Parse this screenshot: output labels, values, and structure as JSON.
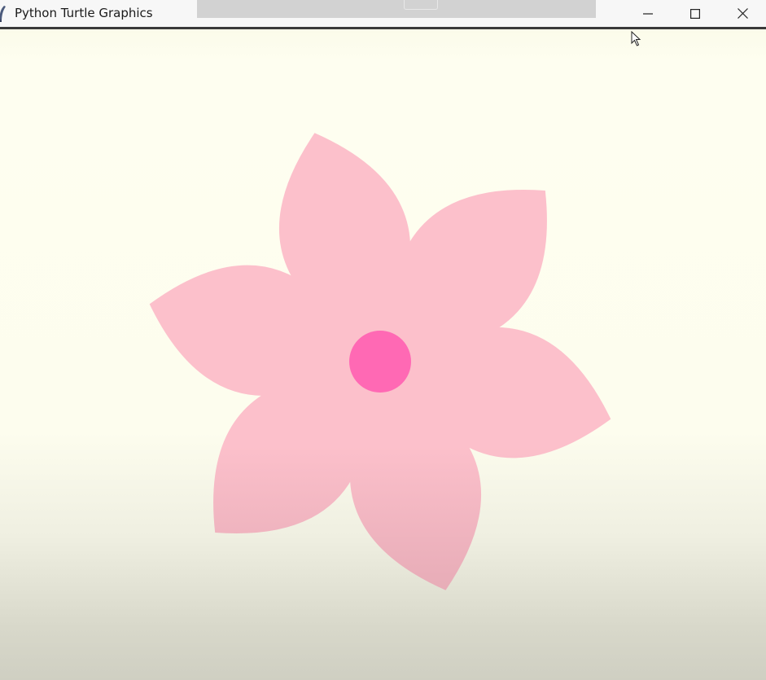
{
  "window": {
    "title": "Python Turtle Graphics",
    "controls": {
      "minimize": "minimize",
      "maximize": "maximize",
      "close": "close"
    }
  },
  "icons": {
    "app": "feather-icon",
    "minimize": "minimize-icon",
    "maximize": "maximize-icon",
    "close": "close-icon",
    "cursor": "mouse-pointer-icon"
  },
  "drawing": {
    "petal_count": 6,
    "colors": {
      "background": "#fdfdee",
      "petal": "#fcc0cb",
      "center": "#ff69b4"
    }
  }
}
